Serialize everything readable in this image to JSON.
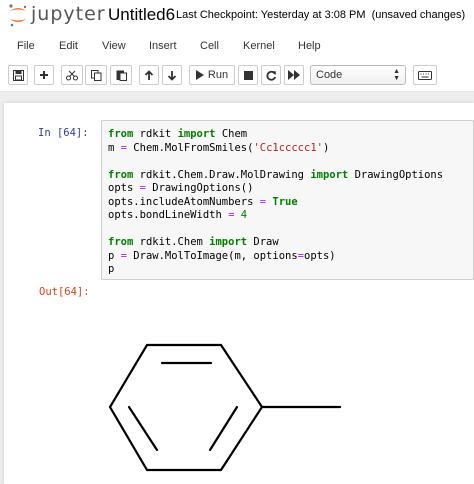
{
  "header": {
    "logo_text": "jupyter",
    "notebook_title": "Untitled6",
    "checkpoint": "Last Checkpoint: Yesterday at 3:08 PM",
    "save_status": "(unsaved changes)"
  },
  "menubar": {
    "items": [
      "File",
      "Edit",
      "View",
      "Insert",
      "Cell",
      "Kernel",
      "Help"
    ]
  },
  "toolbar": {
    "run_label": "Run",
    "cell_type": "Code"
  },
  "cell": {
    "in_prompt": "In [64]:",
    "out_prompt": "Out[64]:",
    "code_lines": [
      [
        {
          "t": "from",
          "c": "kw"
        },
        {
          "t": " rdkit "
        },
        {
          "t": "import",
          "c": "kw"
        },
        {
          "t": " Chem"
        }
      ],
      [
        {
          "t": "m "
        },
        {
          "t": "=",
          "c": "op"
        },
        {
          "t": " Chem.MolFromSmiles("
        },
        {
          "t": "'Cc1ccccc1'",
          "c": "str"
        },
        {
          "t": ")"
        }
      ],
      [],
      [
        {
          "t": "from",
          "c": "kw"
        },
        {
          "t": " rdkit.Chem.Draw.MolDrawing "
        },
        {
          "t": "import",
          "c": "kw"
        },
        {
          "t": " DrawingOptions"
        }
      ],
      [
        {
          "t": "opts "
        },
        {
          "t": "=",
          "c": "op"
        },
        {
          "t": " DrawingOptions()"
        }
      ],
      [
        {
          "t": "opts.includeAtomNumbers "
        },
        {
          "t": "=",
          "c": "op"
        },
        {
          "t": " "
        },
        {
          "t": "True",
          "c": "kw"
        }
      ],
      [
        {
          "t": "opts.bondLineWidth "
        },
        {
          "t": "=",
          "c": "op"
        },
        {
          "t": " "
        },
        {
          "t": "4",
          "c": "num"
        }
      ],
      [],
      [
        {
          "t": "from",
          "c": "kw"
        },
        {
          "t": " rdkit.Chem "
        },
        {
          "t": "import",
          "c": "kw"
        },
        {
          "t": " Draw"
        }
      ],
      [
        {
          "t": "p "
        },
        {
          "t": "=",
          "c": "op"
        },
        {
          "t": " Draw.MolToImage(m, options"
        },
        {
          "t": "=",
          "c": "op"
        },
        {
          "t": "opts)"
        }
      ],
      [
        {
          "t": "p"
        }
      ]
    ]
  },
  "colors": {
    "keyword": "#008000",
    "string": "#ba2121",
    "operator": "#aa22ff",
    "in_prompt": "#303f9f",
    "out_prompt": "#d84315",
    "logo_orange": "#f37726"
  },
  "icons": [
    "save-icon",
    "plus-icon",
    "scissors-icon",
    "copy-icon",
    "paste-icon",
    "arrow-up-icon",
    "arrow-down-icon",
    "play-icon",
    "stop-icon",
    "restart-icon",
    "fast-forward-icon",
    "keyboard-icon"
  ]
}
